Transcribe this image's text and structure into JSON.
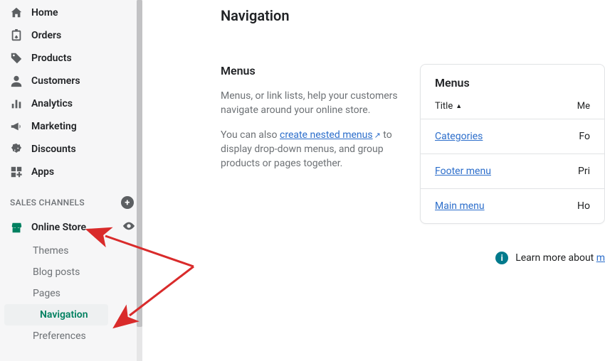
{
  "sidebar": {
    "items": [
      {
        "label": "Home",
        "icon": "home"
      },
      {
        "label": "Orders",
        "icon": "orders"
      },
      {
        "label": "Products",
        "icon": "tag"
      },
      {
        "label": "Customers",
        "icon": "person"
      },
      {
        "label": "Analytics",
        "icon": "bars"
      },
      {
        "label": "Marketing",
        "icon": "megaphone"
      },
      {
        "label": "Discounts",
        "icon": "discount"
      },
      {
        "label": "Apps",
        "icon": "apps"
      }
    ],
    "section_label": "SALES CHANNELS",
    "online_store_label": "Online Store",
    "sub_items": [
      {
        "label": "Themes"
      },
      {
        "label": "Blog posts"
      },
      {
        "label": "Pages"
      },
      {
        "label": "Navigation",
        "active": true
      },
      {
        "label": "Preferences"
      }
    ]
  },
  "main": {
    "page_title": "Navigation",
    "menus_heading": "Menus",
    "menus_p1": "Menus, or link lists, help your customers navigate around your online store.",
    "menus_p2_a": "You can also ",
    "menus_p2_link": "create nested menus",
    "menus_p2_b": "  to display drop-down menus, and group products or pages together.",
    "card": {
      "heading": "Menus",
      "col_title": "Title",
      "col_items": "Me",
      "rows": [
        {
          "title": "Categories",
          "items": "Fo"
        },
        {
          "title": "Footer menu",
          "items": "Pri"
        },
        {
          "title": "Main menu",
          "items": "Ho"
        }
      ]
    },
    "learn_more_prefix": "Learn more about ",
    "learn_more_link": "m"
  }
}
